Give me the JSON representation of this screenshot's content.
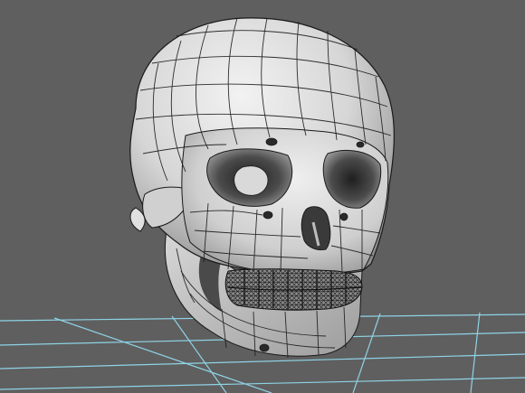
{
  "viewport": {
    "background": "#5f5f5f",
    "grid_color": "#8fd3e6",
    "mesh_color": "#1a1a1a",
    "surface_color": "#dedede"
  },
  "scene": {
    "object": "skull",
    "display_mode": "wireframe-on-shaded",
    "ground_grid": true
  }
}
